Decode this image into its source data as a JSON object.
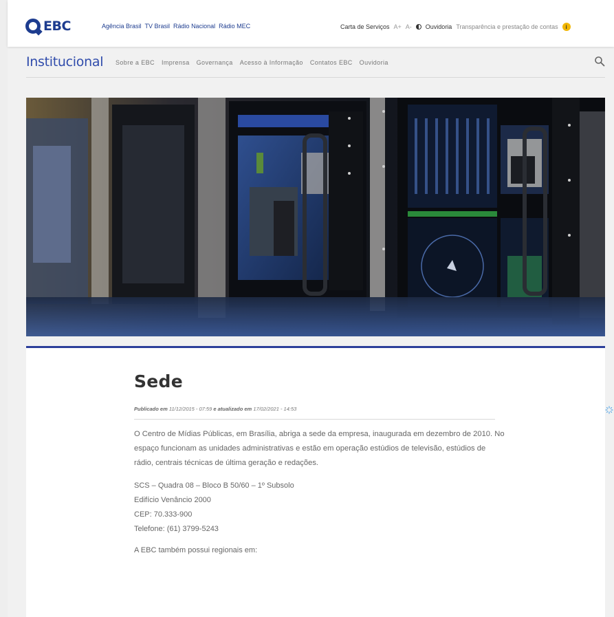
{
  "header": {
    "logo_text": "EBC",
    "links": [
      "Agência Brasil",
      "TV Brasil",
      "Rádio Nacional",
      "Rádio MEC"
    ],
    "right": {
      "services": "Carta de Serviços",
      "font_up": "A+",
      "font_down": "A-",
      "ombudsman": "Ouvidoria",
      "transparency": "Transparência e prestação de contas"
    }
  },
  "subnav": {
    "title": "Institucional",
    "items": [
      "Sobre a EBC",
      "Imprensa",
      "Governança",
      "Acesso à Informação",
      "Contatos EBC",
      "Ouvidoria"
    ]
  },
  "article": {
    "title": "Sede",
    "meta_published_label": "Publicado em",
    "meta_published": "11/12/2015 - 07:59",
    "meta_updated_label": "e atualizado em",
    "meta_updated": "17/02/2021 - 14:53",
    "paragraph": "O Centro de Mídias Públicas, em Brasília, abriga a sede da empresa, inaugurada em dezembro de 2010. No espaço funcionam as unidades administrativas e estão em operação estúdios de televisão, estúdios de rádio, centrais técnicas de última geração e redações.",
    "address": [
      "SCS – Quadra 08 – Bloco B 50/60 – 1º Subsolo",
      "Edifício Venâncio 2000",
      "CEP: 70.333-900",
      "Telefone: (61) 3799-5243"
    ],
    "regionals": "A EBC também possui regionais em:"
  },
  "colors": {
    "brand": "#1d3c8f",
    "accent": "#2c3e9a",
    "info": "#f2b705"
  }
}
